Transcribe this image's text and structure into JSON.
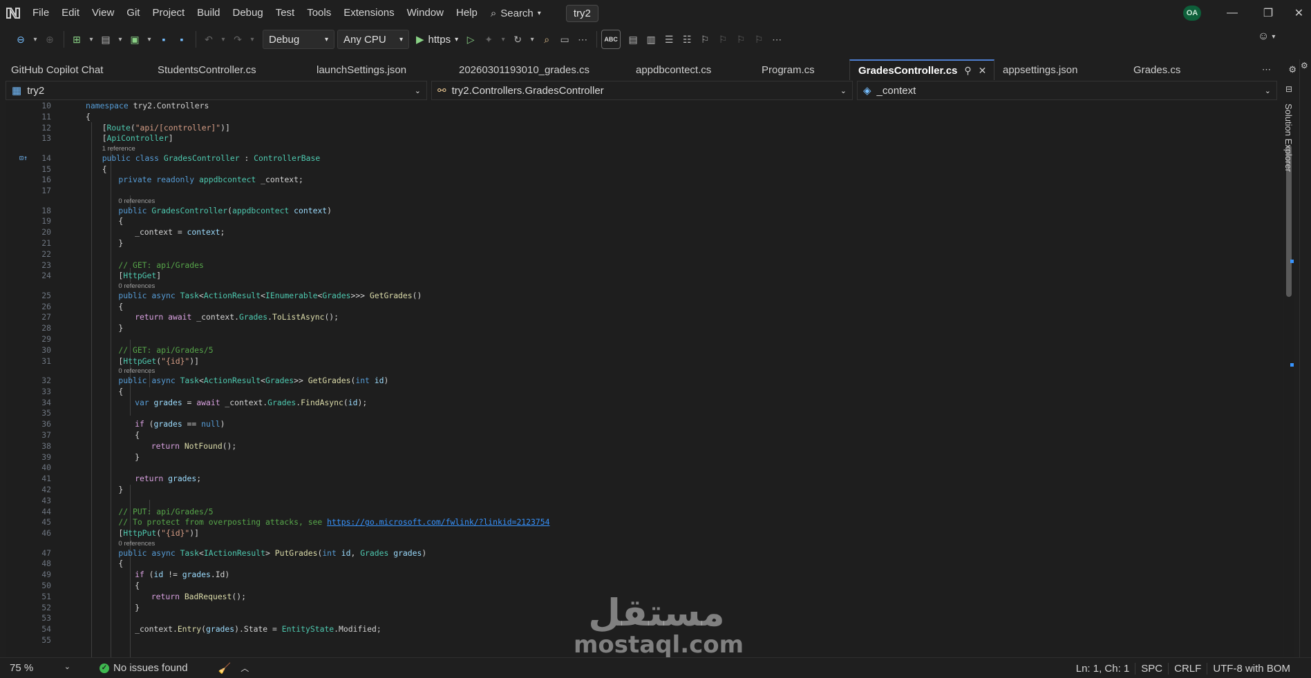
{
  "menu": {
    "items": [
      "File",
      "Edit",
      "View",
      "Git",
      "Project",
      "Build",
      "Debug",
      "Test",
      "Tools",
      "Extensions",
      "Window",
      "Help"
    ],
    "search_label": "Search",
    "solution_name": "try2",
    "avatar_initials": "OA"
  },
  "toolbar": {
    "configuration": "Debug",
    "platform": "Any CPU",
    "run_target": "https"
  },
  "tabs": [
    {
      "label": "GitHub Copilot Chat",
      "active": false
    },
    {
      "label": "StudentsController.cs",
      "active": false
    },
    {
      "label": "launchSettings.json",
      "active": false
    },
    {
      "label": "20260301193010_grades.cs",
      "active": false
    },
    {
      "label": "appdbcontect.cs",
      "active": false
    },
    {
      "label": "Program.cs",
      "active": false
    },
    {
      "label": "GradesController.cs",
      "active": true
    },
    {
      "label": "appsettings.json",
      "active": false
    },
    {
      "label": "Grades.cs",
      "active": false
    }
  ],
  "navbar": {
    "project": "try2",
    "type": "try2.Controllers.GradesController",
    "member": "_context"
  },
  "side_panel": {
    "label": "Solution Explorer"
  },
  "code": {
    "lens_labels": {
      "one_ref": "1 reference",
      "zero_refs": "0 references"
    },
    "lines": [
      {
        "n": "10",
        "t": "namespace try2.Controllers"
      },
      {
        "n": "11",
        "t": "{"
      },
      {
        "n": "12",
        "t": "[Route(\"api/[controller]\")]"
      },
      {
        "n": "13",
        "t": "[ApiController]"
      },
      {
        "n": "14",
        "t": "public class GradesController : ControllerBase"
      },
      {
        "n": "15",
        "t": "{"
      },
      {
        "n": "16",
        "t": "private readonly appdbcontect _context;"
      },
      {
        "n": "17",
        "t": ""
      },
      {
        "n": "18",
        "t": "public GradesController(appdbcontect context)"
      },
      {
        "n": "19",
        "t": "{"
      },
      {
        "n": "20",
        "t": "_context = context;"
      },
      {
        "n": "21",
        "t": "}"
      },
      {
        "n": "22",
        "t": ""
      },
      {
        "n": "23",
        "t": "// GET: api/Grades"
      },
      {
        "n": "24",
        "t": "[HttpGet]"
      },
      {
        "n": "25",
        "t": "public async Task<ActionResult<IEnumerable<Grades>>> GetGrades()"
      },
      {
        "n": "26",
        "t": "{"
      },
      {
        "n": "27",
        "t": "return await _context.Grades.ToListAsync();"
      },
      {
        "n": "28",
        "t": "}"
      },
      {
        "n": "29",
        "t": ""
      },
      {
        "n": "30",
        "t": "// GET: api/Grades/5"
      },
      {
        "n": "31",
        "t": "[HttpGet(\"{id}\")]"
      },
      {
        "n": "32",
        "t": "public async Task<ActionResult<Grades>> GetGrades(int id)"
      },
      {
        "n": "33",
        "t": "{"
      },
      {
        "n": "34",
        "t": "var grades = await _context.Grades.FindAsync(id);"
      },
      {
        "n": "35",
        "t": ""
      },
      {
        "n": "36",
        "t": "if (grades == null)"
      },
      {
        "n": "37",
        "t": "{"
      },
      {
        "n": "38",
        "t": "return NotFound();"
      },
      {
        "n": "39",
        "t": "}"
      },
      {
        "n": "40",
        "t": ""
      },
      {
        "n": "41",
        "t": "return grades;"
      },
      {
        "n": "42",
        "t": "}"
      },
      {
        "n": "43",
        "t": ""
      },
      {
        "n": "44",
        "t": "// PUT: api/Grades/5"
      },
      {
        "n": "45",
        "t": "// To protect from overposting attacks, see https://go.microsoft.com/fwlink/?linkid=2123754"
      },
      {
        "n": "46",
        "t": "[HttpPut(\"{id}\")]"
      },
      {
        "n": "47",
        "t": "public async Task<IActionResult> PutGrades(int id, Grades grades)"
      },
      {
        "n": "48",
        "t": "{"
      },
      {
        "n": "49",
        "t": "if (id != grades.Id)"
      },
      {
        "n": "50",
        "t": "{"
      },
      {
        "n": "51",
        "t": "return BadRequest();"
      },
      {
        "n": "52",
        "t": "}"
      },
      {
        "n": "53",
        "t": ""
      },
      {
        "n": "54",
        "t": "_context.Entry(grades).State = EntityState.Modified;"
      },
      {
        "n": "55",
        "t": ""
      }
    ]
  },
  "watermark": {
    "arabic": "مستقل",
    "latin": "mostaql.com"
  },
  "status": {
    "zoom": "75 %",
    "issues": "No issues found",
    "position": "Ln: 1, Ch: 1",
    "whitespace": "SPC",
    "line_endings": "CRLF",
    "encoding": "UTF-8 with BOM"
  }
}
